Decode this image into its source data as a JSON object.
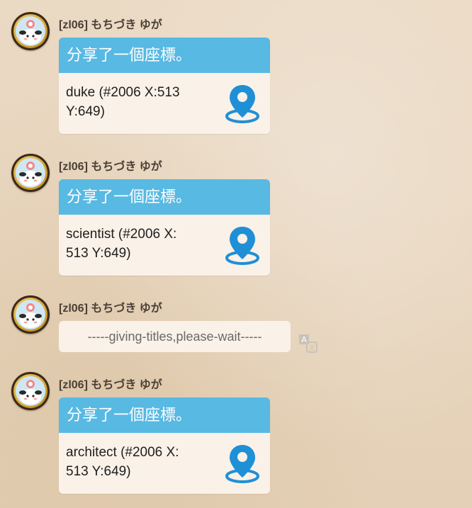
{
  "messages": [
    {
      "sender": "[zl06] もちづき ゆが",
      "type": "coordinate",
      "header": "分享了一個座標。",
      "line1": "duke (#2006 X:513",
      "line2": "Y:649)"
    },
    {
      "sender": "[zl06] もちづき ゆが",
      "type": "coordinate",
      "header": "分享了一個座標。",
      "line1": "scientist (#2006 X:",
      "line2": "513 Y:649)"
    },
    {
      "sender": "[zl06] もちづき ゆが",
      "type": "text",
      "text": "-----giving-titles,please-wait-----"
    },
    {
      "sender": "[zl06] もちづき ゆが",
      "type": "coordinate",
      "header": "分享了一個座標。",
      "line1": "architect (#2006 X:",
      "line2": "513 Y:649)"
    }
  ],
  "icons": {
    "avatar": "avatar-icon",
    "location": "location-pin-icon",
    "translate": "translate-icon"
  },
  "colors": {
    "card_header": "#58b9e3",
    "card_body": "#faf1e8",
    "pin_blue": "#1f8fd6",
    "sender_text": "#4a4036"
  }
}
